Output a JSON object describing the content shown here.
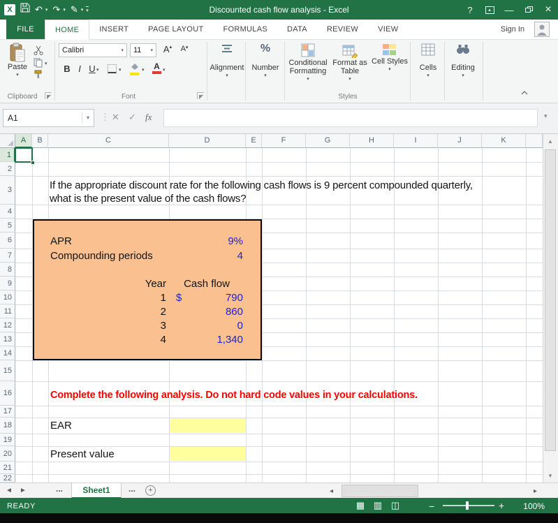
{
  "colors": {
    "excel_green": "#217346",
    "box_fill": "#FAC090",
    "value_blue": "#2222CC",
    "alert_red": "#FF0000",
    "input_yellow": "#FFFF9E"
  },
  "titlebar": {
    "title": "Discounted cash flow analysis - Excel"
  },
  "icons": {
    "undo": "↶",
    "redo": "↷",
    "pen": "✎",
    "caret_down": "▾",
    "caret_up": "▴",
    "help": "?",
    "minimize": "—",
    "close": "×",
    "ellipsis_v": "⋮",
    "cancel": "✕",
    "enter": "✓",
    "percent": "%",
    "launcher": "◢",
    "nav_left": "◄",
    "nav_right": "►",
    "scroll_left": "◂",
    "scroll_right": "▸",
    "scroll_up": "▲",
    "scroll_down": "▼",
    "add_sheet": "+",
    "view_normal": "▦",
    "view_layout": "▥",
    "view_break": "◫",
    "zoom_out": "−",
    "zoom_in": "+"
  },
  "tabs": {
    "file": "FILE",
    "home": "HOME",
    "insert": "INSERT",
    "page_layout": "PAGE LAYOUT",
    "formulas": "FORMULAS",
    "data": "DATA",
    "review": "REVIEW",
    "view": "VIEW",
    "sign_in": "Sign In"
  },
  "ribbon": {
    "paste": "Paste",
    "font_name": "Calibri",
    "font_size": "11",
    "bold": "B",
    "italic": "I",
    "underline": "U",
    "grow_font": "A",
    "shrink_font": "A",
    "alignment": "Alignment",
    "number": "Number",
    "conditional_formatting": "Conditional Formatting",
    "format_as_table": "Format as Table",
    "cell_styles": "Cell Styles",
    "cells": "Cells",
    "editing": "Editing",
    "group_clipboard": "Clipboard",
    "group_font": "Font",
    "group_styles": "Styles"
  },
  "formula_bar": {
    "name_box": "A1",
    "fx": "fx"
  },
  "sheet": {
    "columns": [
      "A",
      "B",
      "C",
      "D",
      "E",
      "F",
      "G",
      "H",
      "I",
      "J",
      "K"
    ],
    "rows": [
      "1",
      "2",
      "3",
      "4",
      "5",
      "6",
      "7",
      "8",
      "9",
      "10",
      "11",
      "12",
      "13",
      "14",
      "15",
      "16",
      "17",
      "18",
      "19",
      "20",
      "21",
      "22"
    ],
    "active_cell": "A1"
  },
  "content": {
    "question_line1": "If the appropriate discount rate for the following cash flows is 9 percent compounded quarterly,",
    "question_line2": "what is the present value of the cash flows?",
    "apr_label": "APR",
    "apr_value": "9%",
    "compounding_label": "Compounding periods",
    "compounding_value": "4",
    "year_header": "Year",
    "cashflow_header": "Cash flow",
    "cashflows": [
      {
        "year": "1",
        "prefix": "$",
        "amount": "790"
      },
      {
        "year": "2",
        "prefix": "",
        "amount": "860"
      },
      {
        "year": "3",
        "prefix": "",
        "amount": "0"
      },
      {
        "year": "4",
        "prefix": "",
        "amount": "1,340"
      }
    ],
    "instruction": "Complete the following analysis. Do not hard code values in your calculations.",
    "ear_label": "EAR",
    "present_value_label": "Present value"
  },
  "sheet_tabs": {
    "prev_ellipsis": "...",
    "sheet1": "Sheet1",
    "next_ellipsis": "..."
  },
  "status_bar": {
    "mode": "READY",
    "zoom": "100%"
  }
}
